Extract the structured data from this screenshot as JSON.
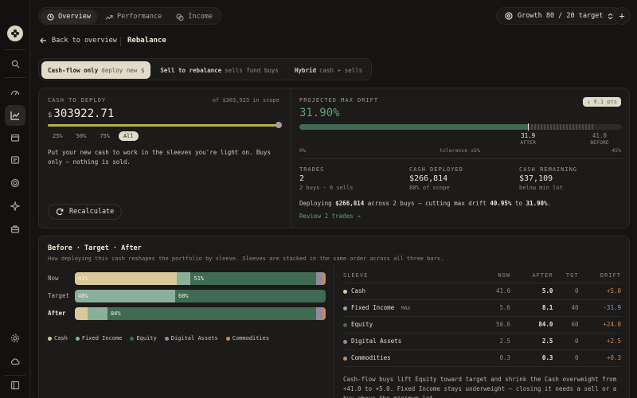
{
  "colors": {
    "accent_green": "#5fa277",
    "cash": "#d9c89b",
    "fixed_income": "#8ab09a",
    "equity": "#3e6b52",
    "digital_assets": "#8f8aa0",
    "commodities": "#c98a5a",
    "negative": "#8c96c9",
    "positive": "#d4864f"
  },
  "sidebar": {
    "icons": [
      "logo-icon",
      "search-icon",
      "gauge-icon",
      "chart-icon",
      "folder-icon",
      "document-icon",
      "target-icon",
      "sparkle-icon",
      "briefcase-icon",
      "settings-icon",
      "cloud-icon",
      "panel-icon"
    ]
  },
  "topnav": {
    "tabs": [
      {
        "label": "Overview",
        "icon": "clock-icon"
      },
      {
        "label": "Performance",
        "icon": "trend-icon"
      },
      {
        "label": "Income",
        "icon": "coins-icon"
      }
    ],
    "active": "Overview"
  },
  "portfolio": {
    "label": "Growth 80 / 20 target"
  },
  "breadcrumb": {
    "back": "Back to overview",
    "current": "Rebalance"
  },
  "modes": [
    {
      "label": "Cash-flow only",
      "sub": "deploy new $"
    },
    {
      "label": "Sell to rebalance",
      "sub": "sells fund buys"
    },
    {
      "label": "Hybrid",
      "sub": "cash + sells"
    }
  ],
  "deploy": {
    "title": "CASH TO DEPLOY",
    "scope": "of $303,923 in scope",
    "currency": "$",
    "amount": "303922.71",
    "slider_fraction": 1.0,
    "presets": [
      "25%",
      "50%",
      "75%",
      "All"
    ],
    "active_preset": "All",
    "description": "Put your new cash to work in the sleeves you're light on. Buys only — nothing is sold.",
    "recalc": "Recalculate"
  },
  "drift": {
    "title": "PROJECTED MAX DRIFT",
    "value": "31.90%",
    "badge": "↓ 9.1 pts",
    "after_val": "31.9",
    "after_lbl": "AFTER",
    "before_val": "41.0",
    "before_lbl": "BEFORE",
    "axis_min": "0%",
    "axis_mid": "tolerance ±5%",
    "axis_max": "45%",
    "after_fraction": 0.709,
    "before_fraction": 0.911
  },
  "stats": [
    {
      "label": "TRADES",
      "value": "2",
      "sub": "2 buys · 0 sells"
    },
    {
      "label": "CASH DEPLOYED",
      "value": "$266,814",
      "sub": "88% of scope"
    },
    {
      "label": "CASH REMAINING",
      "value": "$37,109",
      "sub": "below min lot"
    }
  ],
  "summary": {
    "pre": "Deploying ",
    "amount": "$266,814",
    "mid": " across 2 buys — cutting max drift ",
    "from": "40.95%",
    "to_word": " to ",
    "to": "31.90%",
    "end": ".",
    "review": "Review 2 trades →"
  },
  "compare": {
    "title": "Before · Target · After",
    "desc": "How deploying this cash reshapes the portfolio by sleeve. Sleeves are stacked in the same order across all three bars.",
    "rows": [
      {
        "label": "Now",
        "segs": [
          41.0,
          5.6,
          50.6,
          2.5,
          0.3
        ],
        "labels": [
          "41%",
          "",
          "51%",
          "",
          ""
        ]
      },
      {
        "label": "Target",
        "segs": [
          0,
          40,
          60,
          0,
          0
        ],
        "labels": [
          "",
          "40%",
          "60%",
          "",
          ""
        ]
      },
      {
        "label": "After",
        "segs": [
          5.0,
          8.1,
          84.0,
          2.5,
          0.3
        ],
        "labels": [
          "",
          "",
          "84%",
          "",
          ""
        ]
      }
    ],
    "legend": [
      "Cash",
      "Fixed Income",
      "Equity",
      "Digital Assets",
      "Commodities"
    ]
  },
  "table": {
    "headers": [
      "SLEEVE",
      "NOW",
      "AFTER",
      "TGT",
      "DRIFT"
    ],
    "rows": [
      {
        "name": "Cash",
        "tag": "",
        "now": "41.0",
        "after": "5.0",
        "tgt": "0",
        "drift": "+5.0",
        "drift_kind": "pos"
      },
      {
        "name": "Fixed Income",
        "tag": "MAX",
        "now": "5.6",
        "after": "8.1",
        "tgt": "40",
        "drift": "-31.9",
        "drift_kind": "neg"
      },
      {
        "name": "Equity",
        "tag": "",
        "now": "50.6",
        "after": "84.0",
        "tgt": "60",
        "drift": "+24.0",
        "drift_kind": "pos"
      },
      {
        "name": "Digital Assets",
        "tag": "",
        "now": "2.5",
        "after": "2.5",
        "tgt": "0",
        "drift": "+2.5",
        "drift_kind": "pos"
      },
      {
        "name": "Commodities",
        "tag": "",
        "now": "0.3",
        "after": "0.3",
        "tgt": "0",
        "drift": "+0.3",
        "drift_kind": "pos"
      }
    ],
    "note": "Cash-flow buys lift Equity toward target and shrink the Cash overweight from +41.0 to +5.0. Fixed Income stays underweight — closing it needs a sell or a buy above the minimum lot."
  }
}
